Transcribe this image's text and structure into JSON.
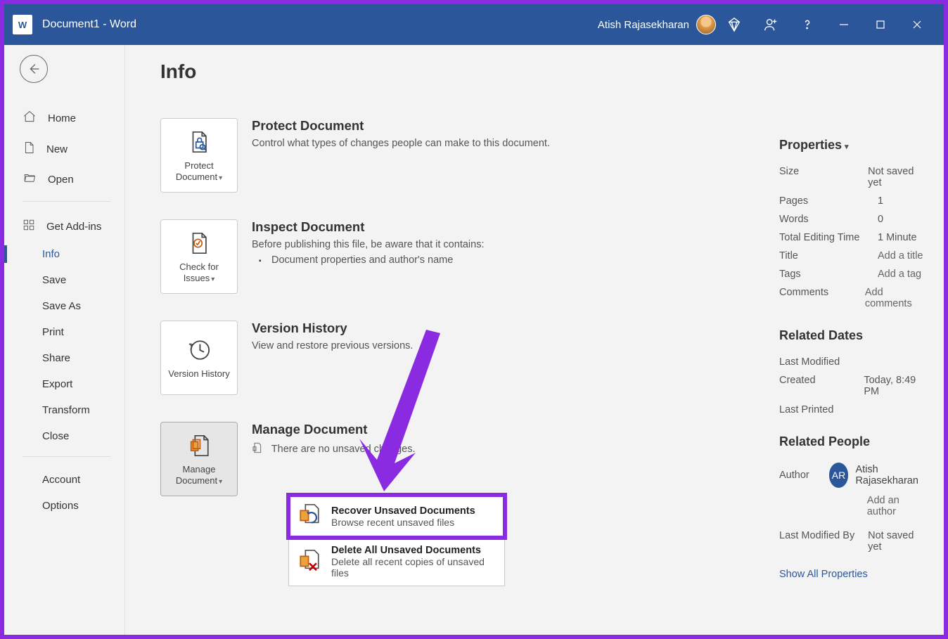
{
  "titlebar": {
    "doc_title": "Document1  -  Word",
    "user_name": "Atish Rajasekharan"
  },
  "sidebar": {
    "home": "Home",
    "new": "New",
    "open": "Open",
    "addins": "Get Add-ins",
    "info": "Info",
    "save": "Save",
    "save_as": "Save As",
    "print": "Print",
    "share": "Share",
    "export": "Export",
    "transform": "Transform",
    "close": "Close",
    "account": "Account",
    "options": "Options"
  },
  "main": {
    "heading": "Info",
    "protect": {
      "tile": "Protect Document",
      "title": "Protect Document",
      "desc": "Control what types of changes people can make to this document."
    },
    "inspect": {
      "tile": "Check for Issues",
      "title": "Inspect Document",
      "desc": "Before publishing this file, be aware that it contains:",
      "item1": "Document properties and author's name"
    },
    "history": {
      "tile": "Version History",
      "title": "Version History",
      "desc": "View and restore previous versions."
    },
    "manage": {
      "tile": "Manage Document",
      "title": "Manage Document",
      "desc": "There are no unsaved changes."
    },
    "menu": {
      "recover_title": "Recover Unsaved Documents",
      "recover_sub": "Browse recent unsaved files",
      "delete_title": "Delete All Unsaved Documents",
      "delete_sub": "Delete all recent copies of unsaved files"
    }
  },
  "props": {
    "heading": "Properties",
    "size_label": "Size",
    "size_val": "Not saved yet",
    "pages_label": "Pages",
    "pages_val": "1",
    "words_label": "Words",
    "words_val": "0",
    "tet_label": "Total Editing Time",
    "tet_val": "1 Minute",
    "title_label": "Title",
    "title_val": "Add a title",
    "tags_label": "Tags",
    "tags_val": "Add a tag",
    "comments_label": "Comments",
    "comments_val": "Add comments",
    "dates_heading": "Related Dates",
    "lm_label": "Last Modified",
    "created_label": "Created",
    "created_val": "Today, 8:49 PM",
    "lp_label": "Last Printed",
    "people_heading": "Related People",
    "author_label": "Author",
    "author_initials": "AR",
    "author_name": "Atish Rajasekharan",
    "add_author": "Add an author",
    "lmb_label": "Last Modified By",
    "lmb_val": "Not saved yet",
    "show_all": "Show All Properties"
  }
}
